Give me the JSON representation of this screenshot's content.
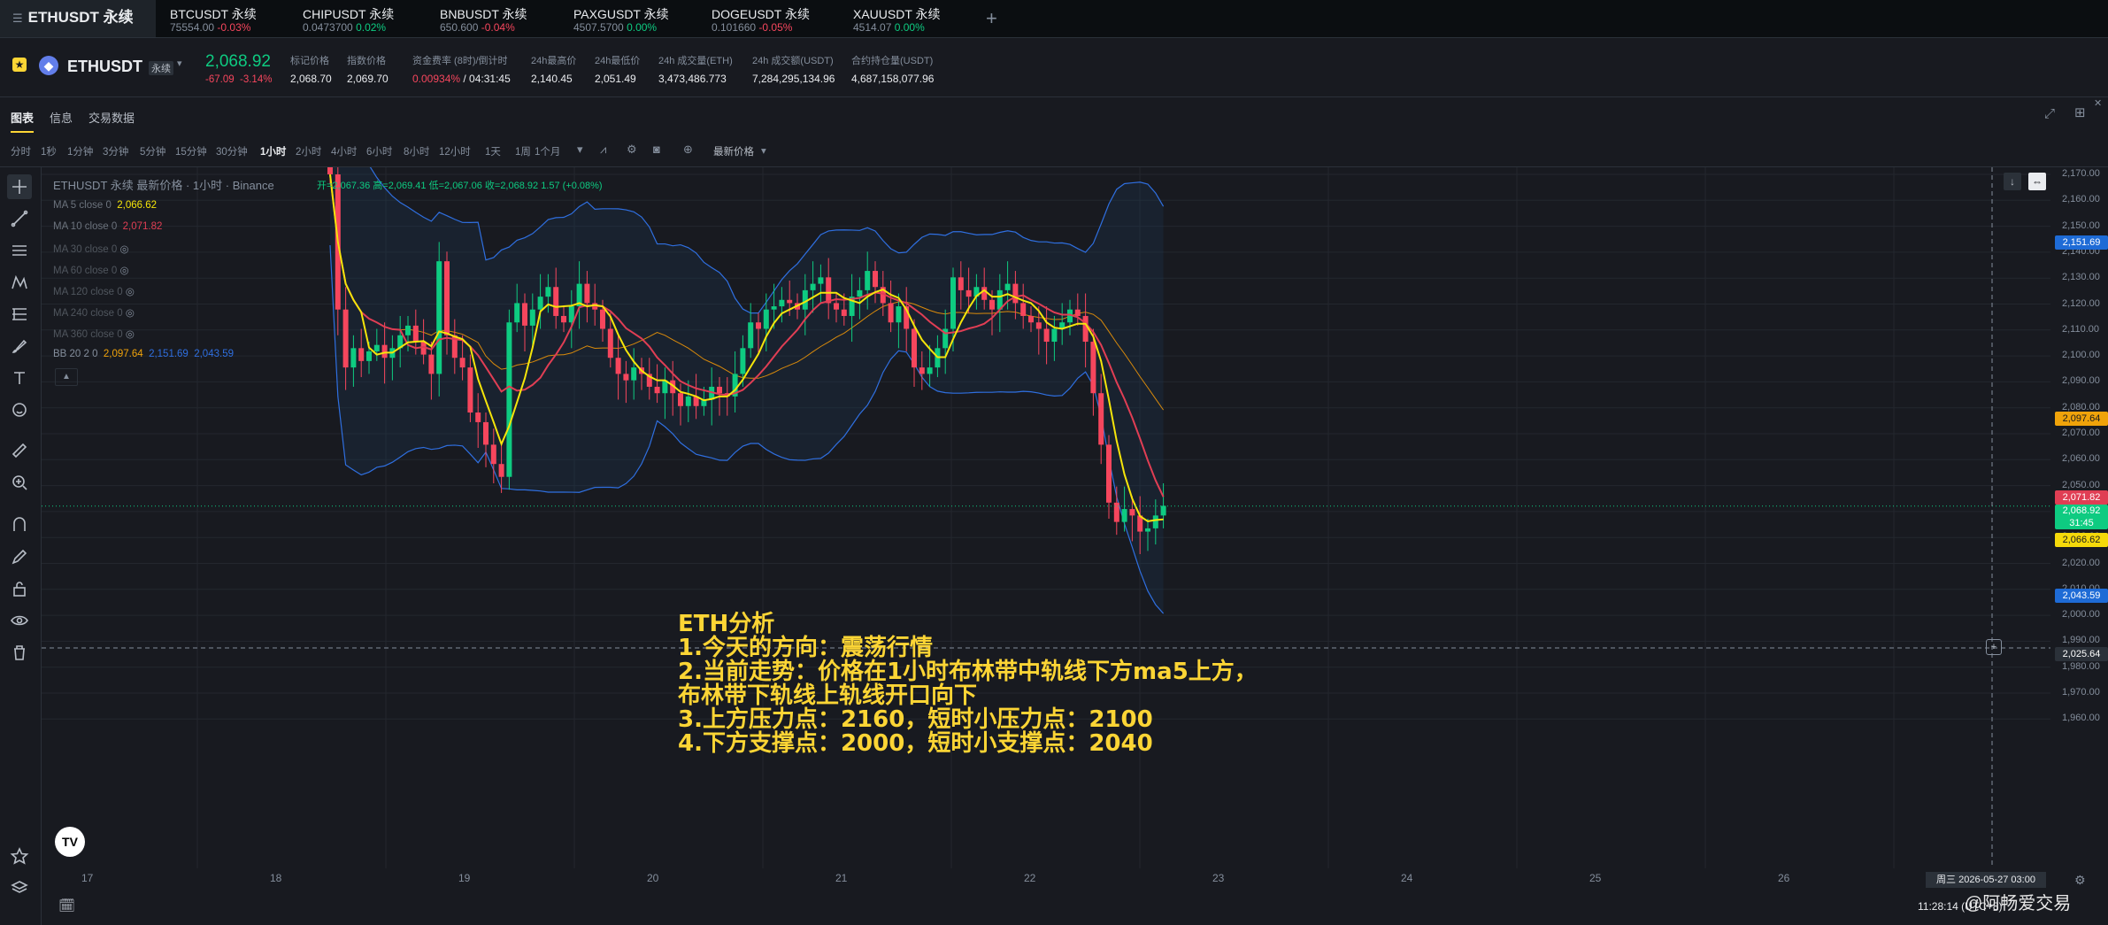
{
  "tabs": [
    {
      "name": "ETHUSDT 永续",
      "sub": "",
      "change": "",
      "active": true
    },
    {
      "name": "BTCUSDT 永续",
      "sub": "75554.00",
      "change": "-0.03%",
      "dir": "neg"
    },
    {
      "name": "CHIPUSDT 永续",
      "sub": "0.0473700",
      "change": "0.02%",
      "dir": "pos"
    },
    {
      "name": "BNBUSDT 永续",
      "sub": "650.600",
      "change": "-0.04%",
      "dir": "neg"
    },
    {
      "name": "PAXGUSDT 永续",
      "sub": "4507.5700",
      "change": "0.00%",
      "dir": "pos"
    },
    {
      "name": "DOGEUSDT 永续",
      "sub": "0.101660",
      "change": "-0.05%",
      "dir": "neg"
    },
    {
      "name": "XAUUSDT 永续",
      "sub": "4514.07",
      "change": "0.00%",
      "dir": "pos"
    }
  ],
  "header": {
    "symbol": "ETHUSDT",
    "badge": "永续",
    "price": "2,068.92",
    "change": "-67.09",
    "change_pct": "-3.14%",
    "stats": [
      {
        "label": "标记价格",
        "value": "2,068.70"
      },
      {
        "label": "指数价格",
        "value": "2,069.70"
      },
      {
        "label": "资金费率 (8时)/倒计时",
        "value": "0.00934%",
        "value2": " / 04:31:45"
      },
      {
        "label": "24h最高价",
        "value": "2,140.45"
      },
      {
        "label": "24h最低价",
        "value": "2,051.49"
      },
      {
        "label": "24h 成交量(ETH)",
        "value": "3,473,486.773"
      },
      {
        "label": "24h 成交额(USDT)",
        "value": "7,284,295,134.96"
      },
      {
        "label": "合约持仓量(USDT)",
        "value": "4,687,158,077.96"
      }
    ]
  },
  "chart_tabs": [
    "图表",
    "信息",
    "交易数据"
  ],
  "intervals": [
    "分时",
    "1秒",
    "1分钟",
    "3分钟",
    "5分钟",
    "15分钟",
    "30分钟",
    "1小时",
    "2小时",
    "4小时",
    "6小时",
    "8小时",
    "12小时",
    "1天",
    "1周",
    "1个月"
  ],
  "active_interval": "1小时",
  "price_mode": "最新价格",
  "legend": {
    "title": "ETHUSDT 永续 最新价格 · 1小时 · Binance",
    "ohlc": "开=2,067.36 高=2,069.41 低=2,067.06 收=2,068.92 1.57 (+0.08%)",
    "ma5": "MA 5 close 0",
    "ma5_val": "2,066.62",
    "ma10": "MA 10 close 0",
    "ma10_val": "2,071.82",
    "ma30": "MA 30 close 0",
    "ma60": "MA 60 close 0",
    "ma120": "MA 120 close 0",
    "ma240": "MA 240 close 0",
    "ma360": "MA 360 close 0",
    "bb": "BB 20 2 0",
    "bb_mid": "2,097.64",
    "bb_up": "2,151.69",
    "bb_low": "2,043.59"
  },
  "price_axis": [
    "2,170.00",
    "2,160.00",
    "2,150.00",
    "2,140.00",
    "2,130.00",
    "2,120.00",
    "2,110.00",
    "2,100.00",
    "2,090.00",
    "2,080.00",
    "2,070.00",
    "2,060.00",
    "2,050.00",
    "2,040.00",
    "2,030.00",
    "2,020.00",
    "2,010.00",
    "2,000.00",
    "1,990.00",
    "1,980.00",
    "1,970.00",
    "1,960.00"
  ],
  "price_tags": [
    {
      "text": "2,151.69",
      "color": "#1e6bd6"
    },
    {
      "text": "2,097.64",
      "color": "#f0a30a"
    },
    {
      "text": "2,071.82",
      "color": "#e03e54"
    },
    {
      "text": "2,068.92",
      "text2": "31:45",
      "color": "#0ecb81"
    },
    {
      "text": "2,066.62",
      "color": "#f5d90a"
    },
    {
      "text": "2,043.59",
      "color": "#1e6bd6"
    },
    {
      "text": "2,025.64",
      "color": "#2b3139"
    }
  ],
  "time_axis": [
    "17",
    "18",
    "19",
    "20",
    "21",
    "22",
    "23",
    "24",
    "25",
    "26"
  ],
  "crosshair_time": "周三 2026-05-27  03:00",
  "clock": "11:28:14 (UTC+8)",
  "watermark": "@阿畅爱交易",
  "annotation": [
    "ETH分析",
    "1.今天的方向：震荡行情",
    "2.当前走势：价格在1小时布林带中轨线下方ma5上方，",
    "布林带下轨线上轨线开口向下",
    "3.上方压力点：2160，短时小压力点：2100",
    "4.下方支撑点：2000，短时小支撑点：2040"
  ],
  "colors": {
    "up": "#0ecb81",
    "down": "#f6465d",
    "ma5": "#f5e50a",
    "ma10": "#e03e54",
    "bb": "#2f6fe0",
    "bb_mid": "#d98a0b"
  },
  "chart_data": {
    "type": "candlestick",
    "timeframe": "1小时",
    "ylim": [
      1958,
      2172
    ],
    "x_ticks": [
      "17",
      "18",
      "19",
      "20",
      "21",
      "22",
      "23",
      "24",
      "25",
      "26"
    ],
    "candles_start": "18 日 08:00",
    "closes": [
      2172,
      2130,
      2112,
      2118,
      2114,
      2117,
      2119,
      2115,
      2118,
      2122,
      2125,
      2120,
      2116,
      2110,
      2145,
      2122,
      2115,
      2112,
      2098,
      2095,
      2088,
      2082,
      2078,
      2126,
      2132,
      2125,
      2130,
      2134,
      2137,
      2128,
      2126,
      2131,
      2138,
      2132,
      2130,
      2124,
      2115,
      2110,
      2108,
      2112,
      2110,
      2106,
      2104,
      2108,
      2104,
      2100,
      2103,
      2100,
      2102,
      2106,
      2104,
      2103,
      2110,
      2118,
      2126,
      2124,
      2130,
      2131,
      2133,
      2132,
      2130,
      2136,
      2138,
      2140,
      2132,
      2130,
      2128,
      2134,
      2136,
      2142,
      2137,
      2132,
      2126,
      2131,
      2124,
      2112,
      2110,
      2112,
      2118,
      2124,
      2140,
      2136,
      2134,
      2137,
      2133,
      2130,
      2136,
      2138,
      2132,
      2128,
      2126,
      2124,
      2120,
      2124,
      2126,
      2130,
      2128,
      2120,
      2104,
      2088,
      2070,
      2064,
      2068,
      2066,
      2061,
      2062,
      2066,
      2069
    ]
  }
}
